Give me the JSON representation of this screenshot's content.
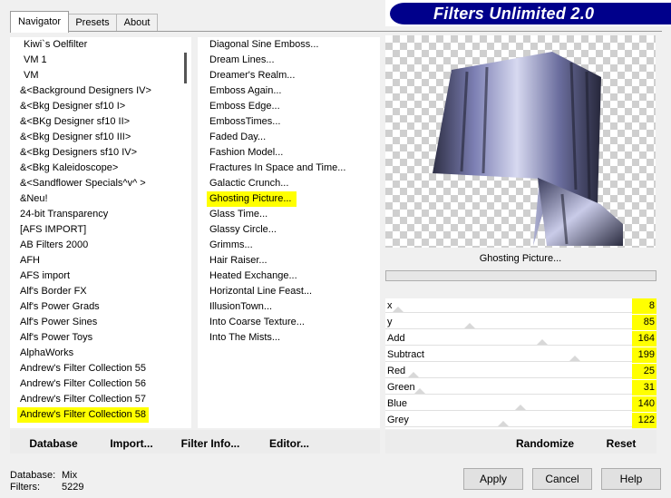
{
  "banner": {
    "title": "Filters Unlimited 2.0"
  },
  "tabs": [
    {
      "label": "Navigator",
      "active": true
    },
    {
      "label": "Presets",
      "active": false
    },
    {
      "label": "About",
      "active": false
    }
  ],
  "categories": [
    {
      "label": "Kiwi`s Oelfilter"
    },
    {
      "label": "VM 1"
    },
    {
      "label": "VM"
    },
    {
      "label": "&<Background Designers IV>"
    },
    {
      "label": "&<Bkg Designer sf10 I>"
    },
    {
      "label": "&<BKg Designer sf10 II>"
    },
    {
      "label": "&<Bkg Designer sf10 III>"
    },
    {
      "label": "&<Bkg Designers sf10 IV>"
    },
    {
      "label": "&<Bkg Kaleidoscope>"
    },
    {
      "label": "&<Sandflower Specials^v^ >"
    },
    {
      "label": "&Neu!"
    },
    {
      "label": "24-bit Transparency"
    },
    {
      "label": "[AFS IMPORT]"
    },
    {
      "label": "AB Filters 2000"
    },
    {
      "label": "AFH"
    },
    {
      "label": "AFS import"
    },
    {
      "label": "Alf's Border FX"
    },
    {
      "label": "Alf's Power Grads"
    },
    {
      "label": "Alf's Power Sines"
    },
    {
      "label": "Alf's Power Toys"
    },
    {
      "label": "AlphaWorks"
    },
    {
      "label": "Andrew's Filter Collection 55"
    },
    {
      "label": "Andrew's Filter Collection 56"
    },
    {
      "label": "Andrew's Filter Collection 57"
    },
    {
      "label": "Andrew's Filter Collection 58",
      "selected": true
    }
  ],
  "filters": [
    {
      "label": "Diagonal Sine Emboss..."
    },
    {
      "label": "Dream Lines..."
    },
    {
      "label": "Dreamer's Realm..."
    },
    {
      "label": "Emboss Again..."
    },
    {
      "label": "Emboss Edge..."
    },
    {
      "label": "EmbossTimes..."
    },
    {
      "label": "Faded Day..."
    },
    {
      "label": "Fashion Model..."
    },
    {
      "label": "Fractures In Space and Time..."
    },
    {
      "label": "Galactic Crunch..."
    },
    {
      "label": "Ghosting Picture...",
      "selected": true
    },
    {
      "label": "Glass Time..."
    },
    {
      "label": "Glassy Circle..."
    },
    {
      "label": "Grimms..."
    },
    {
      "label": "Hair Raiser..."
    },
    {
      "label": "Heated Exchange..."
    },
    {
      "label": "Horizontal Line Feast..."
    },
    {
      "label": "IllusionTown..."
    },
    {
      "label": "Into Coarse Texture..."
    },
    {
      "label": "Into The Mists..."
    }
  ],
  "preview": {
    "caption": "Ghosting Picture..."
  },
  "sliders": [
    {
      "label": "x",
      "value": "8"
    },
    {
      "label": "y",
      "value": "85"
    },
    {
      "label": "Add",
      "value": "164"
    },
    {
      "label": "Subtract",
      "value": "199"
    },
    {
      "label": "Red",
      "value": "25"
    },
    {
      "label": "Green",
      "value": "31"
    },
    {
      "label": "Blue",
      "value": "140"
    },
    {
      "label": "Grey",
      "value": "122"
    }
  ],
  "left_buttons": {
    "database": "Database",
    "import": "Import...",
    "filter_info": "Filter Info...",
    "editor": "Editor..."
  },
  "right_buttons": {
    "randomize": "Randomize",
    "reset": "Reset"
  },
  "status": {
    "database_label": "Database:",
    "database_value": "Mix",
    "filters_label": "Filters:",
    "filters_value": "5229"
  },
  "dialog_buttons": {
    "apply": "Apply",
    "cancel": "Cancel",
    "help": "Help"
  },
  "colors": {
    "banner": "#00008b",
    "highlight": "#ffff00"
  }
}
